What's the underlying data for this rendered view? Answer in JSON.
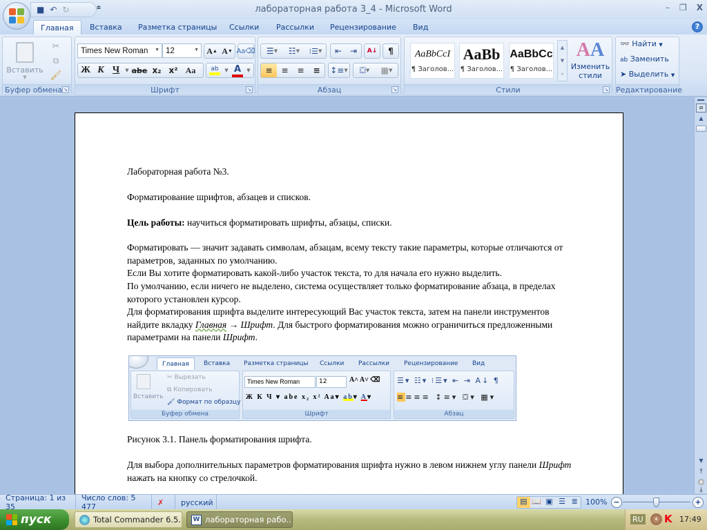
{
  "window": {
    "title": "лабораторная работа 3_4  -  Microsoft Word",
    "controls": {
      "minimize": "–",
      "restore": "❐",
      "close": "X"
    }
  },
  "quick_access": {
    "save": "💾",
    "undo": "↶",
    "redo": "↻",
    "more": "⯆"
  },
  "tabs": [
    {
      "label": "Главная",
      "active": true
    },
    {
      "label": "Вставка"
    },
    {
      "label": "Разметка страницы"
    },
    {
      "label": "Ссылки"
    },
    {
      "label": "Рассылки"
    },
    {
      "label": "Рецензирование"
    },
    {
      "label": "Вид"
    }
  ],
  "help": "?",
  "ribbon": {
    "clipboard": {
      "label": "Буфер обмена",
      "paste": "Вставить"
    },
    "font": {
      "label": "Шрифт",
      "font_name": "Times New Roman",
      "font_size": "12",
      "grow": "A",
      "shrink": "A",
      "bold": "Ж",
      "italic": "К",
      "underline": "Ч",
      "strike": "abe",
      "sub": "x₂",
      "sup": "x²",
      "case": "Aa",
      "highlight_color": "#ffff00",
      "font_color": "#e00000"
    },
    "paragraph": {
      "label": "Абзац",
      "pilcrow": "¶"
    },
    "styles": {
      "label": "Стили",
      "cards": [
        {
          "sample": "AaBbCcI",
          "name": "¶ Заголов..."
        },
        {
          "sample": "AaBb",
          "name": "¶ Заголов..."
        },
        {
          "sample": "AaBbCc",
          "name": "¶ Заголов..."
        }
      ],
      "change_styles": "Изменить стили"
    },
    "editing": {
      "label": "Редактирование",
      "find": "Найти",
      "replace": "Заменить",
      "select": "Выделить"
    }
  },
  "document": {
    "p1": "Лабораторная работа  №3.",
    "p2": "Форматирование шрифтов, абзацев и списков.",
    "p3_bold": "Цель работы:",
    "p3_rest": " научиться форматировать шрифты, абзацы, списки.",
    "p4": "Форматировать — значит задавать символам, абзацам, всему тексту такие параметры, которые отличаются от параметров, заданных по умолчанию.",
    "p5": "Если Вы хотите форматировать какой-либо участок текста, то для начала его нужно выделить.",
    "p6": "По умолчанию, если ничего не выделено, система осуществляет только форматирование абзаца, в пределах которого установлен курсор.",
    "p7_a": "Для форматирования шрифта выделите интересующий Вас участок текста, затем на панели инструментов найдите вкладку ",
    "p7_i1": "Главная",
    "p7_arrow": " → ",
    "p7_i2": "Шрифт",
    "p7_b": ". Для быстрого форматирования можно ограничиться предложенными параметрами на панели ",
    "p7_i3": "Шрифт",
    "p7_end": ".",
    "caption": "Рисунок 3.1. Панель форматирования шрифта.",
    "p8_a": "Для выбора дополнительных параметров форматирования шрифта  нужно в левом нижнем углу панели ",
    "p8_i": "Шрифт",
    "p8_b": " нажать на кнопку со стрелочкой."
  },
  "figure": {
    "tabs": [
      "Главная",
      "Вставка",
      "Разметка страницы",
      "Ссылки",
      "Рассылки",
      "Рецензирование",
      "Вид"
    ],
    "paste": "Вставить",
    "cut": "Вырезать",
    "copy": "Копировать",
    "format_painter": "Формат по образцу",
    "clipboard_label": "Буфер обмена",
    "font_name": "Times New Roman",
    "font_size": "12",
    "font_label": "Шрифт",
    "paragraph_label": "Абзац"
  },
  "statusbar": {
    "page": "Страница: 1 из 35",
    "words": "Число слов: 5 477",
    "language": "русский",
    "zoom": "100%",
    "zoom_level_percent": 100
  },
  "taskbar": {
    "start": "пуск",
    "tasks": [
      {
        "label": "Total Commander 6.5...",
        "active": false
      },
      {
        "label": "лабораторная рабо...",
        "active": true
      }
    ],
    "lang": "RU",
    "clock": "17:49"
  }
}
